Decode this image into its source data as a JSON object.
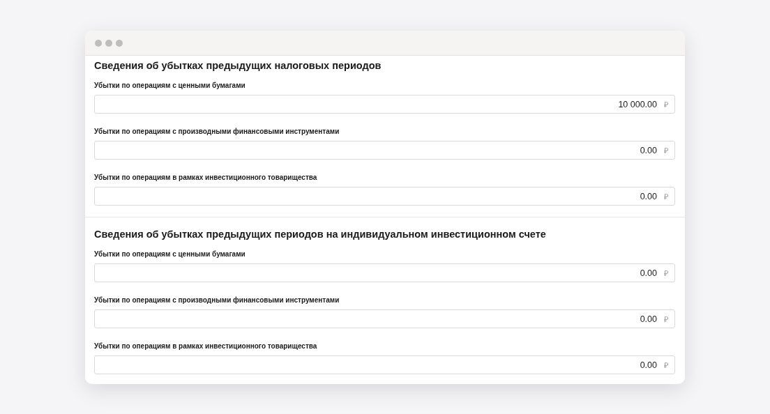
{
  "sections": [
    {
      "title": "Сведения об убытках предыдущих налоговых периодов",
      "fields": [
        {
          "label": "Убытки по операциям с ценными бумагами",
          "value": "10 000.00",
          "currency": "₽"
        },
        {
          "label": "Убытки по операциям с производными финансовыми инструментами",
          "value": "0.00",
          "currency": "₽"
        },
        {
          "label": "Убытки по операциям в рамках инвестиционного товарищества",
          "value": "0.00",
          "currency": "₽"
        }
      ]
    },
    {
      "title": "Сведения об убытках предыдущих периодов на индивидуальном инвестиционном счете",
      "fields": [
        {
          "label": "Убытки по операциям с ценными бумагами",
          "value": "0.00",
          "currency": "₽"
        },
        {
          "label": "Убытки по операциям с производными финансовыми инструментами",
          "value": "0.00",
          "currency": "₽"
        },
        {
          "label": "Убытки по операциям в рамках инвестиционного товарищества",
          "value": "0.00",
          "currency": "₽"
        }
      ]
    }
  ]
}
